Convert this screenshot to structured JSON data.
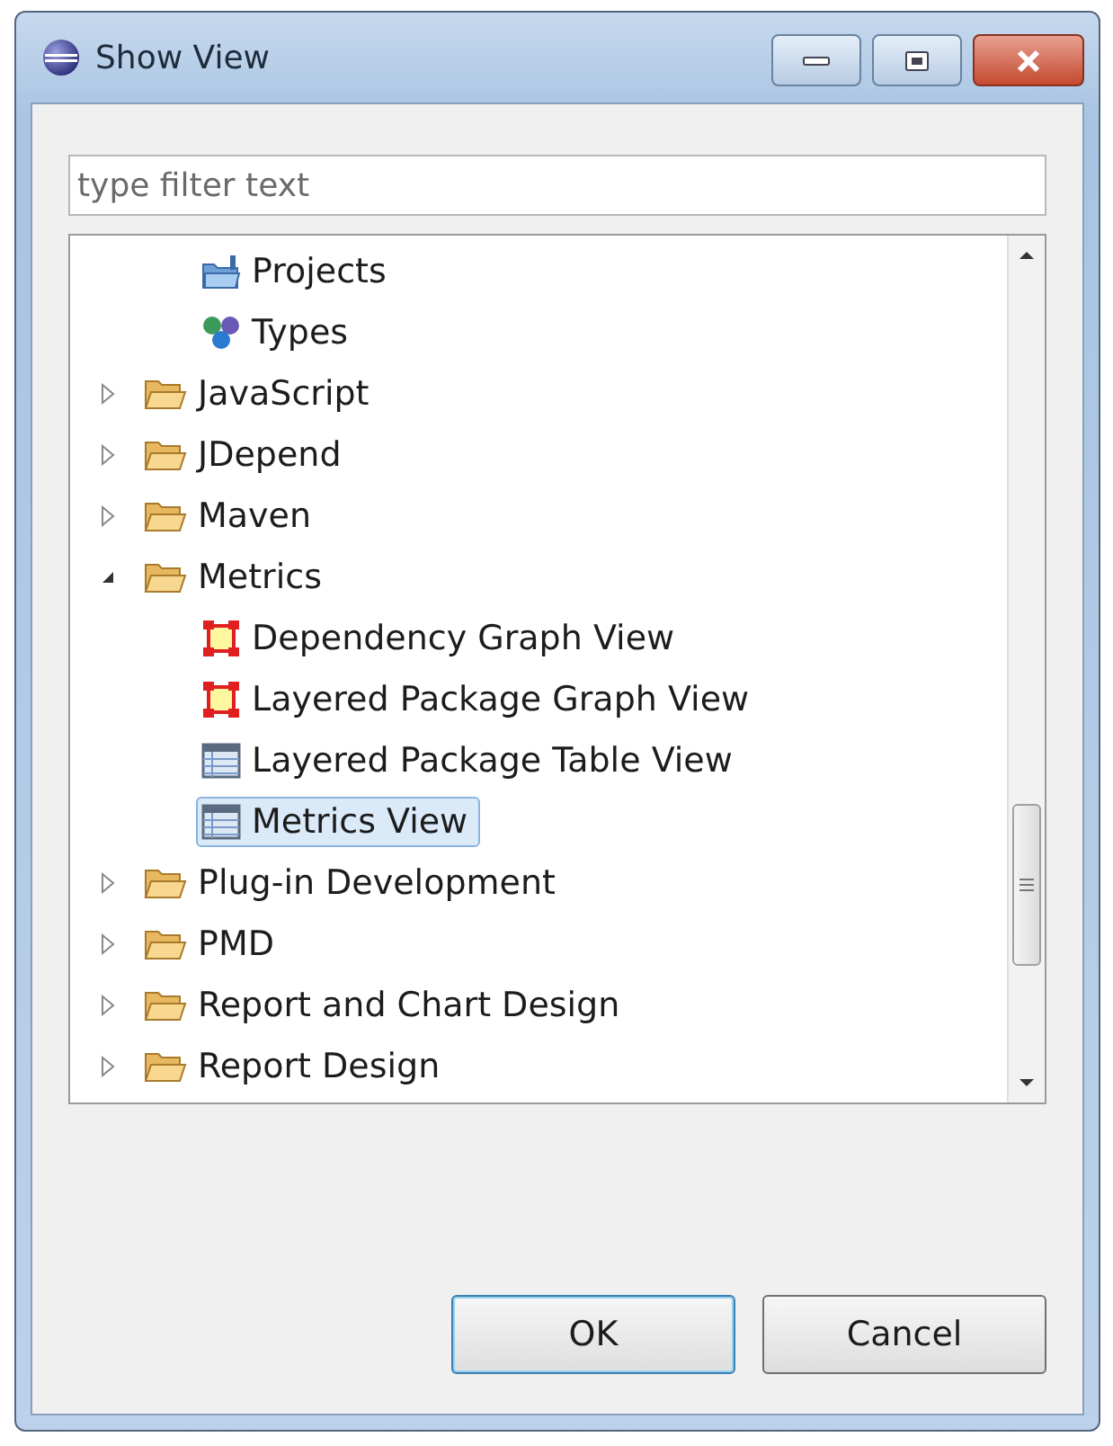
{
  "window": {
    "title": "Show View"
  },
  "filter": {
    "placeholder": "type filter text"
  },
  "tree": {
    "leading_items": [
      {
        "label": "Projects",
        "kind": "projects",
        "selected": false
      },
      {
        "label": "Types",
        "kind": "types",
        "selected": false
      }
    ],
    "folders": [
      {
        "label": "JavaScript",
        "expanded": false,
        "selected": false
      },
      {
        "label": "JDepend",
        "expanded": false,
        "selected": false
      },
      {
        "label": "Maven",
        "expanded": false,
        "selected": false
      },
      {
        "label": "Metrics",
        "expanded": true,
        "selected": false,
        "children": [
          {
            "label": "Dependency Graph View",
            "kind": "graph",
            "selected": false
          },
          {
            "label": "Layered Package Graph View",
            "kind": "graph",
            "selected": false
          },
          {
            "label": "Layered Package Table View",
            "kind": "table",
            "selected": false
          },
          {
            "label": "Metrics View",
            "kind": "table",
            "selected": true
          }
        ]
      },
      {
        "label": "Plug-in Development",
        "expanded": false,
        "selected": false
      },
      {
        "label": "PMD",
        "expanded": false,
        "selected": false
      },
      {
        "label": "Report and Chart Design",
        "expanded": false,
        "selected": false
      },
      {
        "label": "Report Design",
        "expanded": false,
        "selected": false
      }
    ]
  },
  "buttons": [
    {
      "label": "OK",
      "default": true
    },
    {
      "label": "Cancel",
      "default": false
    }
  ]
}
